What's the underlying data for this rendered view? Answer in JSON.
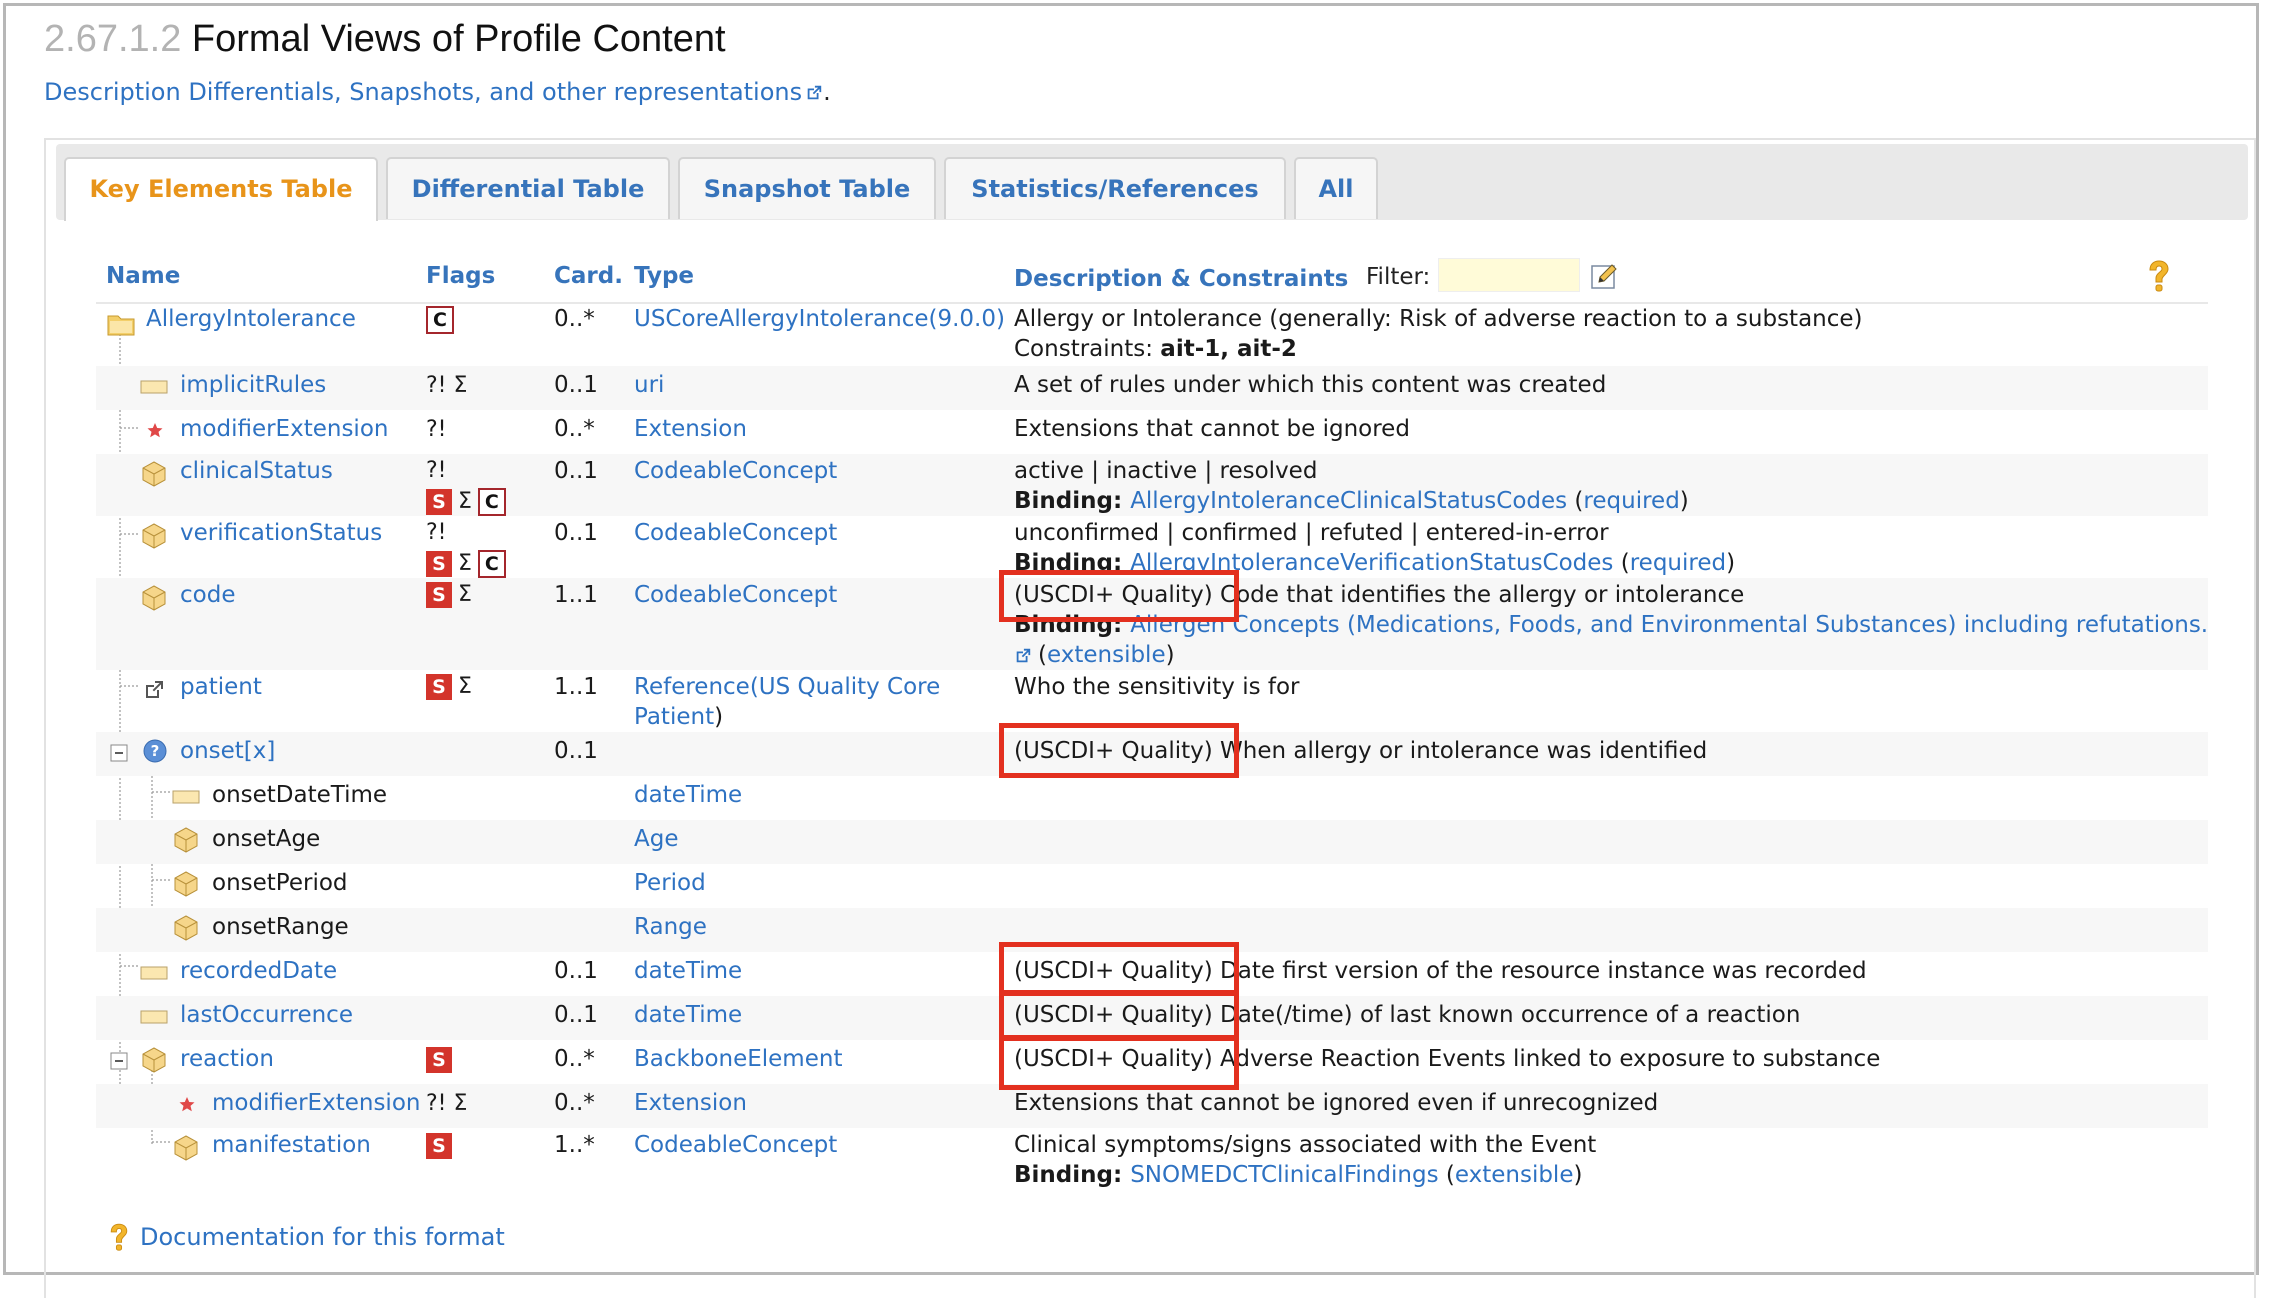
{
  "page": {
    "section_number": "2.67.1.2",
    "section_title": "Formal Views of Profile Content",
    "description_link": "Description Differentials, Snapshots, and other representations",
    "description_suffix": "."
  },
  "tabs": [
    {
      "label": "Key Elements Table",
      "active": true
    },
    {
      "label": "Differential Table",
      "active": false
    },
    {
      "label": "Snapshot Table",
      "active": false
    },
    {
      "label": "Statistics/References",
      "active": false
    },
    {
      "label": "All",
      "active": false
    }
  ],
  "table": {
    "headers": {
      "name": "Name",
      "flags": "Flags",
      "card": "Card.",
      "type": "Type",
      "desc": "Description & Constraints"
    },
    "filter_label": "Filter:",
    "filter_value": "",
    "rows": [
      {
        "name": "AllergyIntolerance",
        "card": "0..*",
        "type": "USCoreAllergyIntolerance(9.0.0)",
        "desc1": "Allergy or Intolerance (generally: Risk of adverse reaction to a substance)",
        "desc2_label": "Constraints: ",
        "desc2_value": "ait-1, ait-2"
      },
      {
        "name": "implicitRules",
        "flags": "?! Σ",
        "card": "0..1",
        "type": "uri",
        "desc1": "A set of rules under which this content was created"
      },
      {
        "name": "modifierExtension",
        "flags": "?!",
        "card": "0..*",
        "type": "Extension",
        "desc1": "Extensions that cannot be ignored"
      },
      {
        "name": "clinicalStatus",
        "flags": "?!",
        "card": "0..1",
        "type": "CodeableConcept",
        "desc1": "active | inactive | resolved",
        "binding_label": "Binding: ",
        "binding_value": "AllergyIntoleranceClinicalStatusCodes",
        "binding_strength": "required"
      },
      {
        "name": "verificationStatus",
        "flags": "?!",
        "card": "0..1",
        "type": "CodeableConcept",
        "desc1": "unconfirmed | confirmed | refuted | entered-in-error",
        "binding_label": "Binding: ",
        "binding_value": "AllergyIntoleranceVerificationStatusCodes",
        "binding_strength": "required"
      },
      {
        "name": "code",
        "card": "1..1",
        "type": "CodeableConcept",
        "desc_prefix": "(USCDI+ Quality)",
        "desc1": " Code that identifies the allergy or intolerance",
        "binding_label": "Binding: ",
        "binding_value": "Allergen Concepts (Medications, Foods, and Environmental Substances) including refutations.",
        "binding_strength": "extensible"
      },
      {
        "name": "patient",
        "card": "1..1",
        "type_prefix": "Reference(",
        "type_link": "US Quality Core",
        "type_link2": "Patient",
        "type_suffix": ")",
        "desc1": "Who the sensitivity is for"
      },
      {
        "name": "onset[x]",
        "card": "0..1",
        "desc_prefix": "(USCDI+ Quality)",
        "desc1": " When allergy or intolerance was identified"
      },
      {
        "name": "onsetDateTime",
        "type": "dateTime"
      },
      {
        "name": "onsetAge",
        "type": "Age"
      },
      {
        "name": "onsetPeriod",
        "type": "Period"
      },
      {
        "name": "onsetRange",
        "type": "Range"
      },
      {
        "name": "recordedDate",
        "card": "0..1",
        "type": "dateTime",
        "desc_prefix": "(USCDI+ Quality)",
        "desc1": " Date first version of the resource instance was recorded"
      },
      {
        "name": "lastOccurrence",
        "card": "0..1",
        "type": "dateTime",
        "desc_prefix": "(USCDI+ Quality)",
        "desc1": " Date(/time) of last known occurrence of a reaction"
      },
      {
        "name": "reaction",
        "card": "0..*",
        "type": "BackboneElement",
        "desc_prefix": "(USCDI+ Quality)",
        "desc1": " Adverse Reaction Events linked to exposure to substance"
      },
      {
        "name": "modifierExtension",
        "flags": "?! Σ",
        "card": "0..*",
        "type": "Extension",
        "desc1": "Extensions that cannot be ignored even if unrecognized"
      },
      {
        "name": "manifestation",
        "card": "1..*",
        "type": "CodeableConcept",
        "desc1": "Clinical symptoms/signs associated with the Event",
        "binding_label": "Binding: ",
        "binding_value": "SNOMEDCTClinicalFindings",
        "binding_strength": "extensible"
      }
    ]
  },
  "badges": {
    "s": "S",
    "c": "C",
    "sigma": "Σ",
    "modifier": "?!"
  },
  "footer_link": "Documentation for this format",
  "colors": {
    "link": "#2e72c2",
    "active_tab": "#e8941a",
    "highlight": "#e3301f",
    "must_support": "#d3342b"
  },
  "icons": [
    "external-link-icon",
    "resource-folder-icon",
    "primitive-icon",
    "extension-star-icon",
    "datatype-cube-icon",
    "reference-icon",
    "choice-icon",
    "collapse-icon",
    "edit-icon",
    "help-icon"
  ]
}
